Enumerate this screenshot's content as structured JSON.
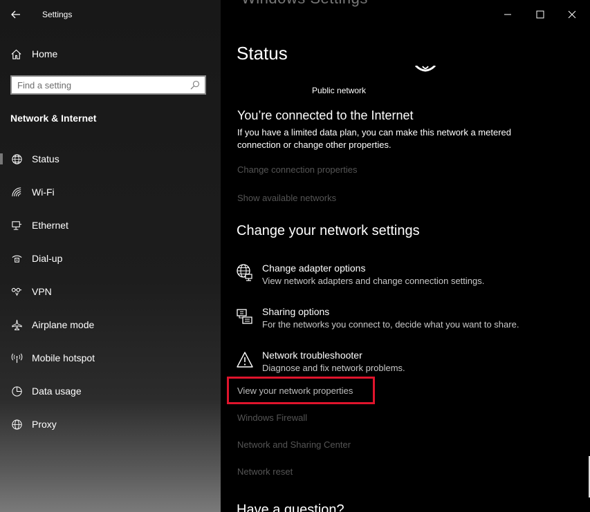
{
  "window": {
    "app_title": "Settings",
    "background_title": "Windows Settings",
    "controls": [
      "minimize-icon",
      "maximize-icon",
      "close-icon"
    ]
  },
  "sidebar": {
    "back_icon": "back-arrow-icon",
    "home_label": "Home",
    "search_placeholder": "Find a setting",
    "section_heading": "Network & Internet",
    "items": [
      {
        "label": "Status",
        "icon": "status-globe-icon",
        "selected": true
      },
      {
        "label": "Wi-Fi",
        "icon": "wifi-icon",
        "selected": false
      },
      {
        "label": "Ethernet",
        "icon": "ethernet-icon",
        "selected": false
      },
      {
        "label": "Dial-up",
        "icon": "dialup-icon",
        "selected": false
      },
      {
        "label": "VPN",
        "icon": "vpn-icon",
        "selected": false
      },
      {
        "label": "Airplane mode",
        "icon": "airplane-icon",
        "selected": false
      },
      {
        "label": "Mobile hotspot",
        "icon": "hotspot-icon",
        "selected": false
      },
      {
        "label": "Data usage",
        "icon": "data-usage-icon",
        "selected": false
      },
      {
        "label": "Proxy",
        "icon": "proxy-globe-icon",
        "selected": false
      }
    ]
  },
  "main": {
    "title": "Status",
    "network_type": "Public network",
    "connected_heading": "You’re connected to the Internet",
    "connected_desc": "If you have a limited data plan, you can make this network a metered connection or change other properties.",
    "links_top": [
      "Change connection properties",
      "Show available networks"
    ],
    "change_heading": "Change your network settings",
    "options": [
      {
        "title": "Change adapter options",
        "sub": "View network adapters and change connection settings.",
        "icon": "adapter-globe-icon"
      },
      {
        "title": "Sharing options",
        "sub": "For the networks you connect to, decide what you want to share.",
        "icon": "sharing-icon"
      },
      {
        "title": "Network troubleshooter",
        "sub": "Diagnose and fix network problems.",
        "icon": "warning-icon"
      }
    ],
    "view_properties": "View your network properties",
    "links_bottom": [
      "Windows Firewall",
      "Network and Sharing Center",
      "Network reset"
    ],
    "question_heading": "Have a question?"
  },
  "colors": {
    "highlight_border": "#e0142c",
    "dim_link": "#555555",
    "background": "#000000"
  }
}
